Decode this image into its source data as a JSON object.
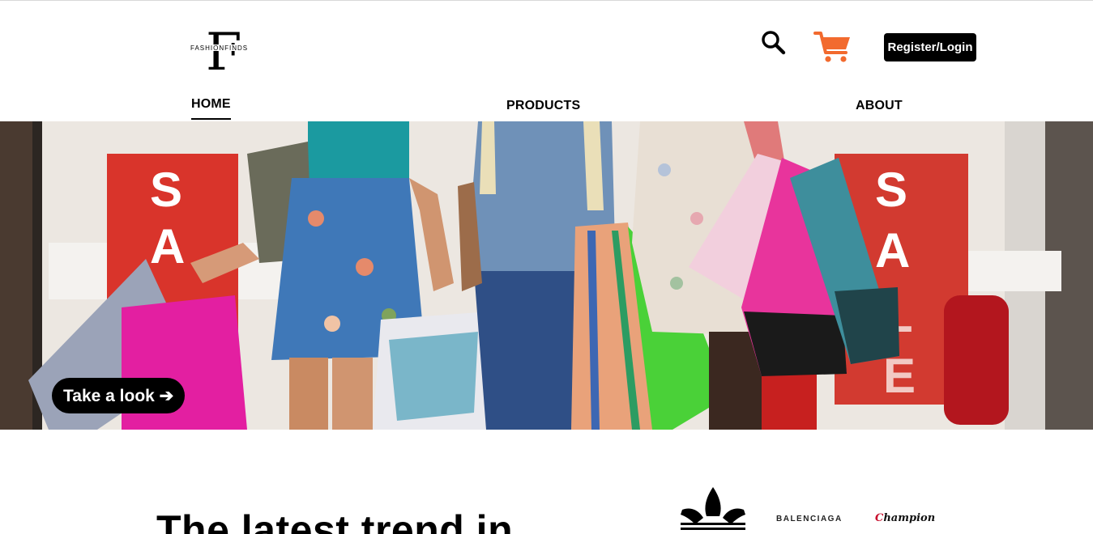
{
  "header": {
    "logo_letter": "F",
    "logo_text": "FASHIONFINDS",
    "icons": {
      "search": "search-icon",
      "cart": "cart-icon"
    },
    "cart_color": "#f26a2e",
    "register_label": "Register/Login"
  },
  "nav": {
    "items": [
      {
        "label": "HOME",
        "active": true
      },
      {
        "label": "PRODUCTS",
        "active": false
      },
      {
        "label": "ABOUT",
        "active": false
      }
    ]
  },
  "hero": {
    "cta_label": "Take a look ➔",
    "store_sign_letters": [
      "S",
      "A",
      "S",
      "A",
      "L",
      "E"
    ]
  },
  "main": {
    "headline": "The latest trend in"
  },
  "brands": {
    "balenciaga": "BALENCIAGA",
    "champion": "Champion"
  }
}
